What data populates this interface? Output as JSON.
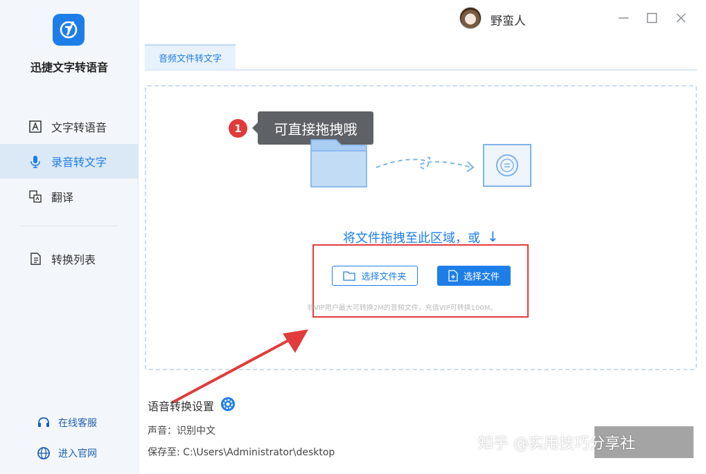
{
  "app": {
    "name": "迅捷文字转语音"
  },
  "sidebar": {
    "items": [
      {
        "label": "文字转语音",
        "icon": "text-to-speech-icon"
      },
      {
        "label": "录音转文字",
        "icon": "microphone-icon",
        "active": true
      },
      {
        "label": "翻译",
        "icon": "translate-icon"
      },
      {
        "label": "转换列表",
        "icon": "conversion-list-icon"
      }
    ],
    "links": [
      {
        "label": "在线客服",
        "icon": "customer-service-icon"
      },
      {
        "label": "进入官网",
        "icon": "globe-icon"
      }
    ]
  },
  "titlebar": {
    "username": "野蛮人"
  },
  "tabs": [
    {
      "label": "音频文件转文字"
    }
  ],
  "dropzone": {
    "tooltip_number": "1",
    "tooltip_text": "可直接拖拽哦",
    "drag_text": "将文件拖拽至此区域，或",
    "drag_arrow": "↓",
    "folder_button": "选择文件夹",
    "file_button": "选择文件",
    "vip_note": "非VIP用户最大可转换2M的音频文件，充值VIP可转换100M。"
  },
  "settings": {
    "title": "语音转换设置",
    "voice": "声音：识别中文",
    "save_to": "保存至: C:\\Users\\Administrator\\desktop"
  },
  "watermark": "知乎 @实用技巧分享社",
  "colors": {
    "accent": "#1e7ee8",
    "highlight": "#e23b3b",
    "sidebar_bg": "#f3f7fb"
  }
}
